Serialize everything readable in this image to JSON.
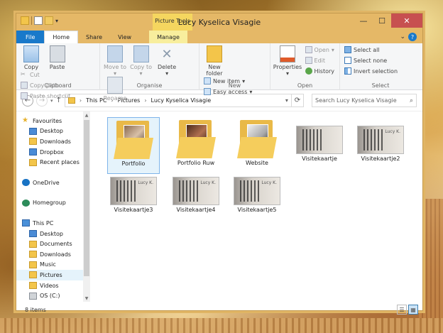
{
  "window": {
    "title": "Lucy Kyselica Visagie",
    "context_tab": "Picture Tools"
  },
  "tabs": [
    "File",
    "Home",
    "Share",
    "View",
    "Manage"
  ],
  "ribbon": {
    "clipboard": {
      "label": "Clipboard",
      "copy": "Copy",
      "paste": "Paste",
      "cut": "Cut",
      "copy_path": "Copy path",
      "paste_shortcut": "Paste shortcut"
    },
    "organise": {
      "label": "Organise",
      "move_to": "Move to",
      "copy_to": "Copy to",
      "delete": "Delete",
      "rename": "Rename"
    },
    "new": {
      "label": "New",
      "new_folder": "New folder",
      "new_item": "New item",
      "easy_access": "Easy access"
    },
    "open": {
      "label": "Open",
      "properties": "Properties",
      "open": "Open",
      "edit": "Edit",
      "history": "History"
    },
    "select": {
      "label": "Select",
      "select_all": "Select all",
      "select_none": "Select none",
      "invert_selection": "Invert selection"
    }
  },
  "address": {
    "crumbs": [
      "This PC",
      "Pictures",
      "Lucy Kyselica Visagie"
    ],
    "search_placeholder": "Search Lucy Kyselica Visagie"
  },
  "nav": {
    "favourites": "Favourites",
    "fav_items": [
      "Desktop",
      "Downloads",
      "Dropbox",
      "Recent places"
    ],
    "onedrive": "OneDrive",
    "homegroup": "Homegroup",
    "thispc": "This PC",
    "pc_items": [
      "Desktop",
      "Documents",
      "Downloads",
      "Music",
      "Pictures",
      "Videos",
      "OS (C:)"
    ]
  },
  "files": [
    {
      "name": "Portfolio",
      "kind": "folder"
    },
    {
      "name": "Portfolio Ruw",
      "kind": "folder"
    },
    {
      "name": "Website",
      "kind": "folder"
    },
    {
      "name": "Visitekaartje",
      "kind": "image"
    },
    {
      "name": "Visitekaartje2",
      "kind": "image"
    },
    {
      "name": "Visitekaartje3",
      "kind": "image"
    },
    {
      "name": "Visitekaartje4",
      "kind": "image"
    },
    {
      "name": "Visitekaartje5",
      "kind": "image"
    }
  ],
  "card_text": "Lucy K.",
  "status": "8 items"
}
